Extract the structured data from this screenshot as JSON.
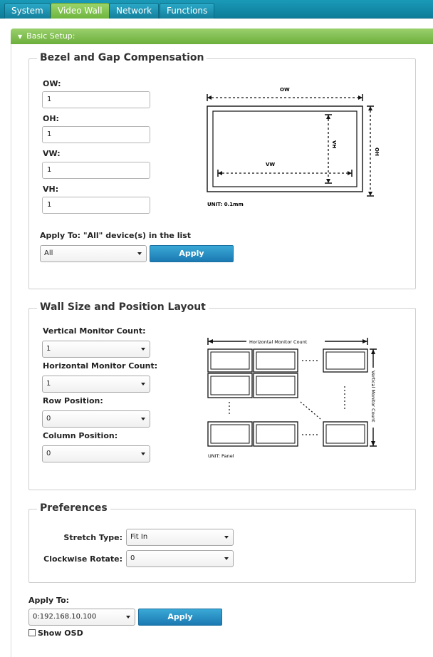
{
  "tabs": [
    "System",
    "Video Wall",
    "Network",
    "Functions"
  ],
  "section": {
    "title": "Basic Setup:"
  },
  "bezel": {
    "legend": "Bezel and Gap Compensation",
    "fields": [
      {
        "label": "OW:",
        "value": "1"
      },
      {
        "label": "OH:",
        "value": "1"
      },
      {
        "label": "VW:",
        "value": "1"
      },
      {
        "label": "VH:",
        "value": "1"
      }
    ],
    "diagram": {
      "ow": "OW",
      "oh": "OH",
      "vw": "VW",
      "vh": "VH",
      "unit": "UNIT: 0.1mm"
    },
    "apply_to_label": "Apply To: \"All\" device(s) in the list",
    "apply_select": "All",
    "apply_button": "Apply"
  },
  "wall": {
    "legend": "Wall Size and Position Layout",
    "fields": [
      {
        "label": "Vertical Monitor Count:",
        "value": "1"
      },
      {
        "label": "Horizontal Monitor Count:",
        "value": "1"
      },
      {
        "label": "Row Position:",
        "value": "0"
      },
      {
        "label": "Column Position:",
        "value": "0"
      }
    ],
    "diagram": {
      "h_label": "Horizontal Monitor Count",
      "v_label": "Vertical Monitor Count",
      "unit": "UNIT: Panel"
    }
  },
  "prefs": {
    "legend": "Preferences",
    "stretch_label": "Stretch Type:",
    "stretch_value": "Fit In",
    "rotate_label": "Clockwise Rotate:",
    "rotate_value": "0"
  },
  "footer": {
    "apply_to_label": "Apply To:",
    "device_value": "0:192.168.10.100",
    "apply_button": "Apply",
    "show_osd_label": "Show OSD"
  }
}
